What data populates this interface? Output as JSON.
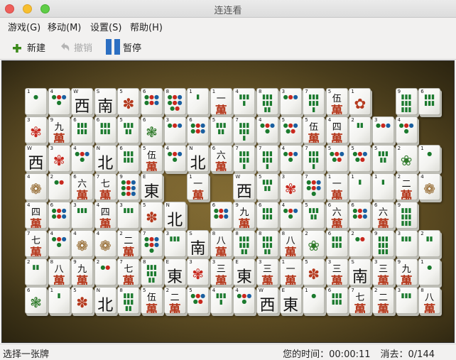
{
  "window": {
    "title": "连连看"
  },
  "menu": [
    "游戏(G)",
    "移动(M)",
    "设置(S)",
    "帮助(H)"
  ],
  "toolbar": {
    "new_label": "新建",
    "undo_label": "撤销",
    "pause_label": "暂停",
    "new_color": "#3b8a1a",
    "pause_color": "#2c6fc2"
  },
  "status": {
    "message": "选择一张牌",
    "time": "您的时间：00:00:11",
    "removed": "消去：0/144"
  },
  "board": {
    "rows": [
      [
        "d1",
        "d4",
        "wW",
        "wS",
        "f5",
        "d6",
        "d8",
        "b1",
        "c1",
        "b4",
        "b8",
        "d3",
        "b7",
        "c5",
        "f1",
        "",
        "b9",
        "b6"
      ],
      [
        "f3",
        "c9",
        "b6",
        "b6",
        "b5",
        "f6",
        "d3",
        "d6",
        "b5",
        "b7",
        "d4",
        "d5",
        "c5",
        "c4",
        "b2",
        "d3",
        "d4",
        ""
      ],
      [
        "wW",
        "f3",
        "d4",
        "wN",
        "b6",
        "c5",
        "d4",
        "wN",
        "c6",
        "b7",
        "b7",
        "d4",
        "b7",
        "d5",
        "d5",
        "b5",
        "f2",
        "d1"
      ],
      [
        "f4",
        "d2",
        "c6",
        "c7",
        "d9",
        "wE",
        "",
        "c1",
        "",
        "wW",
        "b5",
        "f3",
        "d7",
        "c1",
        "b1",
        "b1",
        "c2",
        "f4"
      ],
      [
        "c4",
        "d6",
        "b3",
        "c4",
        "b3",
        "f5",
        "wN",
        "",
        "d6",
        "c9",
        "b6",
        "d4",
        "b5",
        "c6",
        "d6",
        "c6",
        "b9",
        ""
      ],
      [
        "c7",
        "d4",
        "f4",
        "f4",
        "c2",
        "d7",
        "b3",
        "wS",
        "c8",
        "b8",
        "b8",
        "c8",
        "f2",
        "b6",
        "d2",
        "b9",
        "b3",
        "b2"
      ],
      [
        "b2",
        "c8",
        "c9",
        "d2",
        "c7",
        "b8",
        "wE",
        "f3",
        "c3",
        "wE",
        "c3",
        "c1",
        "f5",
        "c3",
        "wS",
        "c3",
        "c9",
        "d1"
      ],
      [
        "f6",
        "b1",
        "f5",
        "wN",
        "b8",
        "c5",
        "c2",
        "d5",
        "b4",
        "d4",
        "wW",
        "wE",
        "d1",
        "b6",
        "c7",
        "c2",
        "b3",
        "c8"
      ]
    ]
  }
}
